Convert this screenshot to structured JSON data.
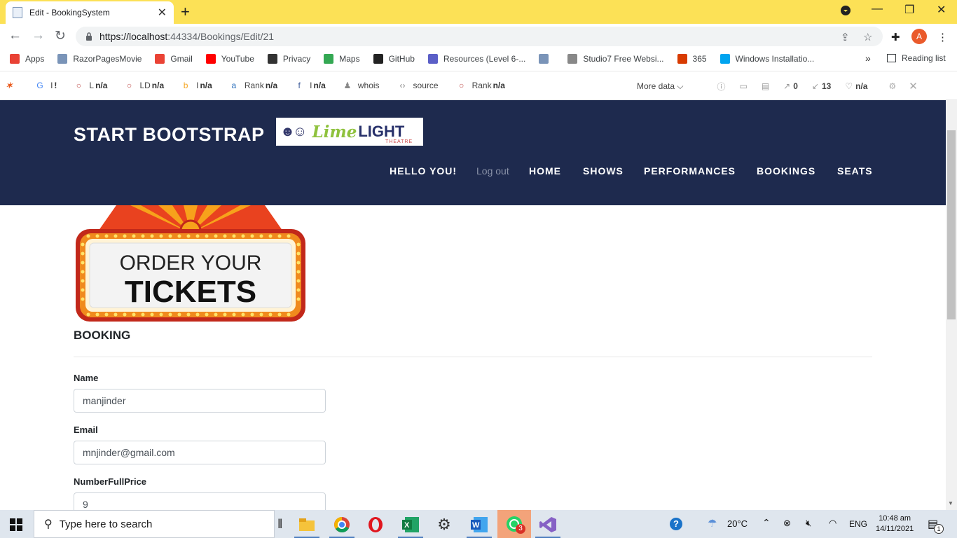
{
  "browser": {
    "tab_title": "Edit - BookingSystem",
    "url_host": "https://localhost",
    "url_rest": ":44334/Bookings/Edit/21",
    "avatar_letter": "A"
  },
  "bookmarks": {
    "items": [
      {
        "label": "Apps",
        "icon": "apps-grid-icon",
        "color": "#e94235"
      },
      {
        "label": "RazorPagesMovie",
        "icon": "page-icon",
        "color": "#7a94b8"
      },
      {
        "label": "Gmail",
        "icon": "gmail-icon",
        "color": "#ea4335"
      },
      {
        "label": "YouTube",
        "icon": "youtube-icon",
        "color": "#ff0000"
      },
      {
        "label": "Privacy",
        "icon": "globe-icon",
        "color": "#333333"
      },
      {
        "label": "Maps",
        "icon": "maps-icon",
        "color": "#34a853"
      },
      {
        "label": "GitHub",
        "icon": "github-icon",
        "color": "#222222"
      },
      {
        "label": "Resources (Level 6-...",
        "icon": "teams-icon",
        "color": "#5b5fc7"
      },
      {
        "label": "",
        "icon": "page-icon",
        "color": "#7a94b8"
      },
      {
        "label": "Studio7 Free Websi...",
        "icon": "studio7-icon",
        "color": "#888888"
      },
      {
        "label": "365",
        "icon": "office-icon",
        "color": "#d83b01"
      },
      {
        "label": "Windows Installatio...",
        "icon": "windows-icon",
        "color": "#00a4ef"
      }
    ],
    "more": "»",
    "reading_list": "Reading list"
  },
  "seobar": {
    "items": [
      {
        "icon": "google-icon",
        "label": "I",
        "value": "!"
      },
      {
        "icon": "circle-icon",
        "label": "L",
        "value": "n/a"
      },
      {
        "icon": "circle-icon",
        "label": "LD",
        "value": "n/a"
      },
      {
        "icon": "bing-icon",
        "label": "I",
        "value": "n/a"
      },
      {
        "icon": "rank-icon",
        "label": "Rank",
        "value": "n/a"
      },
      {
        "icon": "facebook-icon",
        "label": "I",
        "value": "n/a"
      },
      {
        "icon": "user-icon",
        "label": "whois",
        "value": ""
      },
      {
        "icon": "code-icon",
        "label": "source",
        "value": ""
      },
      {
        "icon": "circle-icon",
        "label": "Rank",
        "value": "n/a"
      }
    ],
    "more_data": "More data",
    "links_out": "0",
    "links_in": "13",
    "heart_value": "n/a"
  },
  "site": {
    "brand": "START BOOTSTRAP",
    "logo_lime": "Lime",
    "logo_light": "LIGHT",
    "logo_theatre": "THEATRE",
    "nav": {
      "hello": "HELLO YOU!",
      "logout": "Log out",
      "home": "HOME",
      "shows": "SHOWS",
      "performances": "PERFORMANCES",
      "bookings": "BOOKINGS",
      "seats": "SEATS"
    }
  },
  "banner": {
    "line1": "ORDER YOUR",
    "line2": "TICKETS"
  },
  "form": {
    "heading": "BOOKING",
    "name_label": "Name",
    "name_value": "manjinder",
    "email_label": "Email",
    "email_value": "mnjinder@gmail.com",
    "price_label": "NumberFullPrice",
    "price_value": "9"
  },
  "taskbar": {
    "search_placeholder": "Type here to search",
    "weather": "20°C",
    "language": "ENG",
    "time": "10:48 am",
    "date": "14/11/2021",
    "notification_count": "1",
    "whatsapp_badge": "3"
  }
}
